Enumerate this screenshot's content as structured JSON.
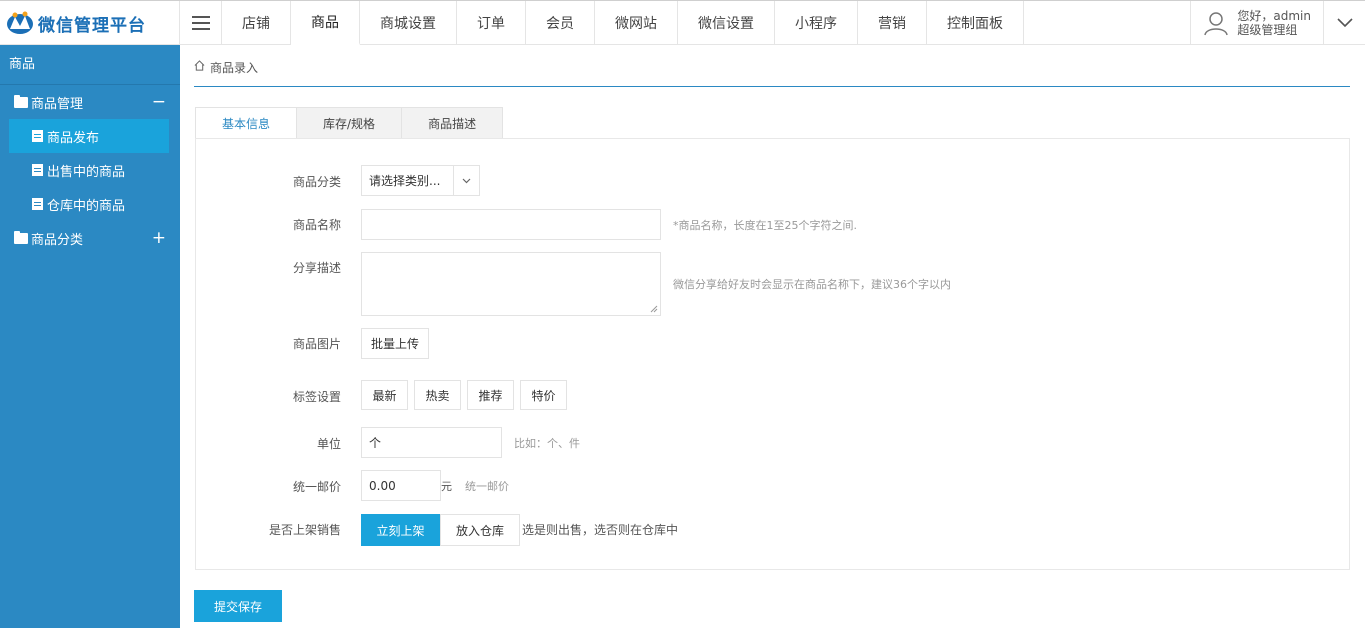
{
  "header": {
    "app_title": "微信管理平台",
    "nav": [
      "店铺",
      "商品",
      "商城设置",
      "订单",
      "会员",
      "微网站",
      "微信设置",
      "小程序",
      "营销",
      "控制面板"
    ],
    "active_nav": 1,
    "user_greeting": "您好，admin",
    "user_role": "超级管理组"
  },
  "sidebar": {
    "title": "商品",
    "groups": [
      {
        "label": "商品管理",
        "toggle": "−",
        "items": [
          "商品发布",
          "出售中的商品",
          "仓库中的商品"
        ]
      },
      {
        "label": "商品分类",
        "toggle": "+",
        "items": []
      }
    ]
  },
  "main": {
    "breadcrumb": "商品录入",
    "tabs": [
      "基本信息",
      "库存/规格",
      "商品描述"
    ],
    "form": {
      "category_label": "商品分类",
      "category_value": "请选择类别...",
      "name_label": "商品名称",
      "name_hint": "*商品名称，长度在1至25个字符之间.",
      "share_label": "分享描述",
      "share_hint": "微信分享给好友时会显示在商品名称下，建议36个字以内",
      "image_label": "商品图片",
      "image_button": "批量上传",
      "tags_label": "标签设置",
      "tags": [
        "最新",
        "热卖",
        "推荐",
        "特价"
      ],
      "unit_label": "单位",
      "unit_value": "个",
      "unit_hint": "比如：个、件",
      "shipping_label": "统一邮价",
      "shipping_value": "0.00",
      "shipping_unit": "元",
      "shipping_hint": "统一邮价",
      "onsale_label": "是否上架销售",
      "onsale_yes": "立刻上架",
      "onsale_no": "放入仓库",
      "onsale_hint": "选是则出售，选否则在仓库中"
    },
    "submit": "提交保存"
  },
  "colors": {
    "sidebar_bg": "#2b89c3",
    "accent": "#1aa3db",
    "logo_text": "#1b6fb6"
  }
}
